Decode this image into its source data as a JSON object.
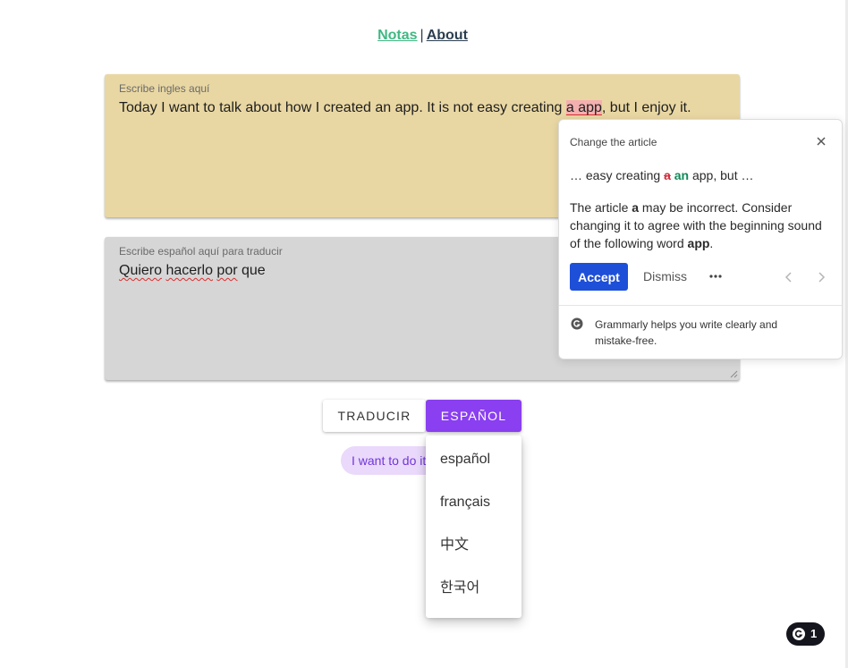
{
  "nav": {
    "notas": "Notas",
    "separator": "|",
    "about": "About"
  },
  "english_field": {
    "label": "Escribe ingles aquí",
    "text_before": "Today I want to talk about how I created an app. It is not easy creating ",
    "text_highlight": "a app",
    "text_after": ", but I enjoy it."
  },
  "spanish_field": {
    "label": "Escribe español aquí para traducir",
    "words": [
      "Quiero",
      "hacerlo",
      "por",
      "que"
    ]
  },
  "buttons": {
    "translate": "TRADUCIR",
    "language": "ESPAÑOL"
  },
  "result_chip": "I want to do it",
  "language_menu": [
    "español",
    "français",
    "中文",
    "한국어"
  ],
  "grammarly_card": {
    "title": "Change the article",
    "snippet_prefix": "… easy creating ",
    "snippet_removed": "a",
    "snippet_added": "an",
    "snippet_suffix": " app, but …",
    "desc_1": "The article ",
    "desc_word": "a",
    "desc_2": " may be incorrect. Consider changing it to agree with the beginning sound of the following word ",
    "desc_target": "app",
    "desc_3": ".",
    "accept": "Accept",
    "dismiss": "Dismiss",
    "footer": "Grammarly helps you write clearly and mistake-free."
  },
  "grammarly_badge": {
    "count": "1"
  },
  "colors": {
    "accent_purple": "#8a3ff0",
    "english_bg": "#e9d7a3",
    "spanish_bg": "#d6d6d6",
    "nav_green": "#40b883",
    "accept_blue": "#1e4fd8"
  }
}
